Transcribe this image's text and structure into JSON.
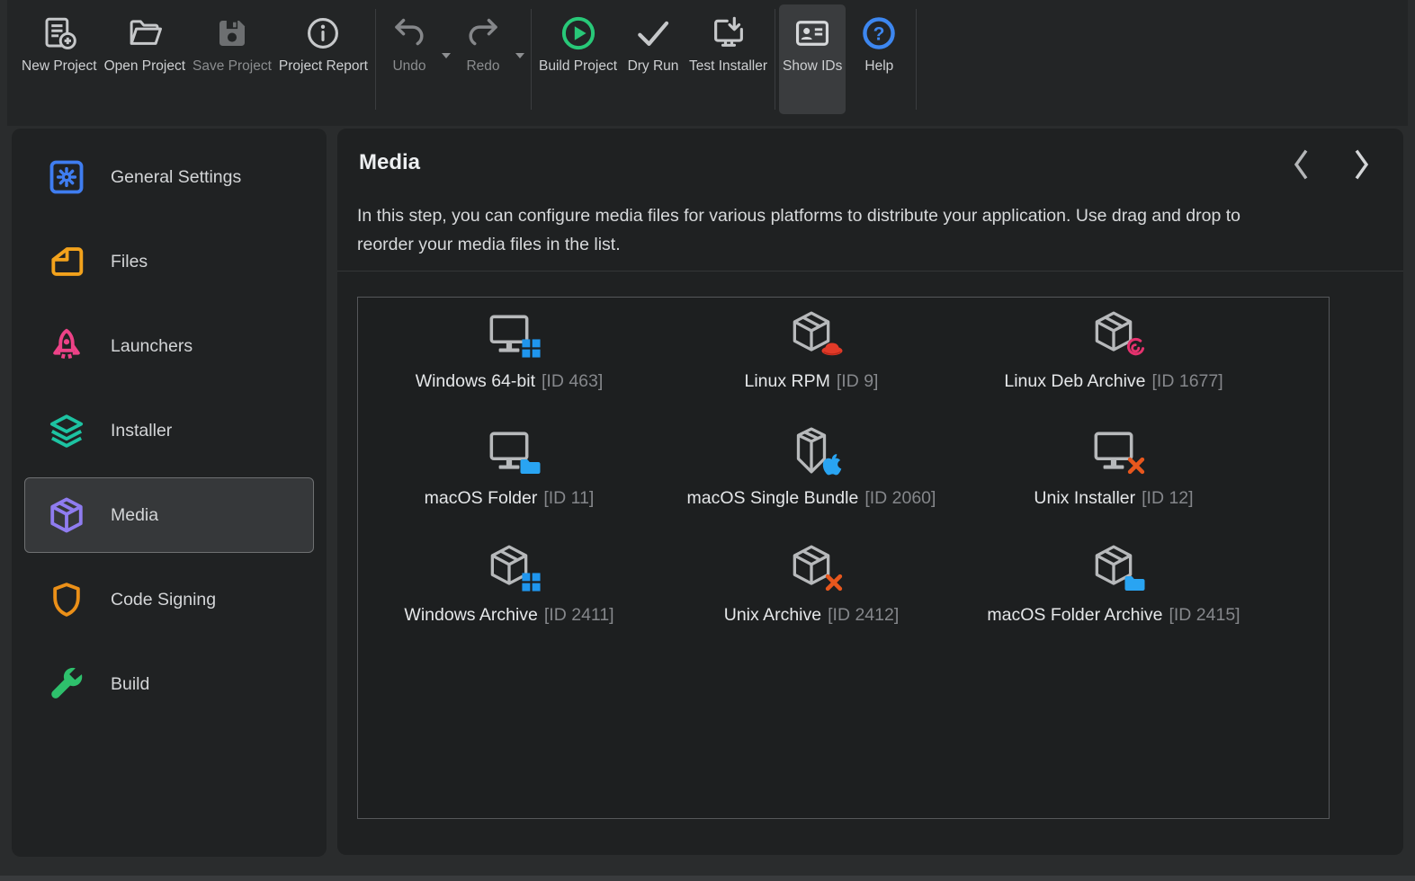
{
  "toolbar": {
    "file_buttons": [
      {
        "label": "New Project"
      },
      {
        "label": "Open Project"
      },
      {
        "label": "Save Project",
        "enabled": false
      },
      {
        "label": "Project Report"
      }
    ],
    "undo": {
      "label": "Undo",
      "enabled": false
    },
    "redo": {
      "label": "Redo",
      "enabled": false
    },
    "build_buttons": [
      {
        "label": "Build Project"
      },
      {
        "label": "Dry Run"
      },
      {
        "label": "Test Installer"
      }
    ],
    "show_ids": {
      "label": "Show IDs",
      "active": true
    },
    "help": {
      "label": "Help"
    }
  },
  "sidebar": {
    "items": [
      {
        "label": "General Settings",
        "color": "#3f7df0",
        "selected": false
      },
      {
        "label": "Files",
        "color": "#f2a21c",
        "selected": false
      },
      {
        "label": "Launchers",
        "color": "#ed4287",
        "selected": false
      },
      {
        "label": "Installer",
        "color": "#1dc3a2",
        "selected": false
      },
      {
        "label": "Media",
        "color": "#8f7cf0",
        "selected": true
      },
      {
        "label": "Code Signing",
        "color": "#eb9018",
        "selected": false
      },
      {
        "label": "Build",
        "color": "#2ec06c",
        "selected": false
      }
    ]
  },
  "main": {
    "title": "Media",
    "description": "In this step, you can configure media files for various platforms to distribute your application. Use drag and drop to reorder your media files in the list.",
    "media_items": [
      {
        "name": "Windows 64-bit",
        "id_label": "[ID 463]",
        "base": "monitor",
        "badge": "windows"
      },
      {
        "name": "Linux RPM",
        "id_label": "[ID 9]",
        "base": "box",
        "badge": "redhat"
      },
      {
        "name": "Linux Deb Archive",
        "id_label": "[ID 1677]",
        "base": "box",
        "badge": "debian"
      },
      {
        "name": "macOS Folder",
        "id_label": "[ID 11]",
        "base": "monitor",
        "badge": "folder"
      },
      {
        "name": "macOS Single Bundle",
        "id_label": "[ID 2060]",
        "base": "tallbox",
        "badge": "apple"
      },
      {
        "name": "Unix Installer",
        "id_label": "[ID 12]",
        "base": "monitor",
        "badge": "x"
      },
      {
        "name": "Windows Archive",
        "id_label": "[ID 2411]",
        "base": "box",
        "badge": "windows"
      },
      {
        "name": "Unix Archive",
        "id_label": "[ID 2412]",
        "base": "box",
        "badge": "x"
      },
      {
        "name": "macOS Folder Archive",
        "id_label": "[ID 2415]",
        "base": "box",
        "badge": "folder"
      }
    ]
  },
  "icons": {
    "help_glyph": "?"
  },
  "colors": {
    "window_bg": "#2a2c2d",
    "toolbar_bg": "#232526",
    "panel_bg": "#1f2122",
    "selected_item_bg": "#36383a",
    "icon_gray": "#b7b9bb",
    "accent_blue": "#1f96ee",
    "accent_green": "#28c878",
    "accent_red": "#e23a28",
    "accent_pink": "#e5326e",
    "accent_orange_x": "#e8571d",
    "help_blue": "#3d87f0"
  }
}
